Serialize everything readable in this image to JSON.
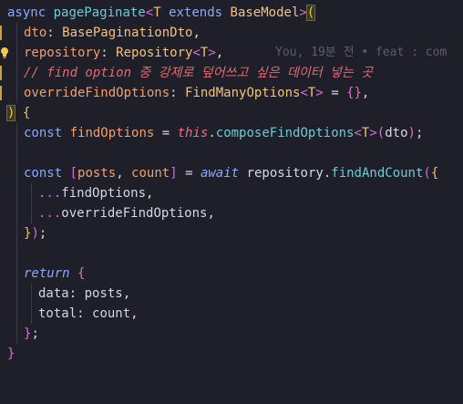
{
  "editor": {
    "line1": {
      "kw_async": "async",
      "fn_name": "pagePaginate",
      "lt": "<",
      "tparam": "T",
      "kw_extends": "extends",
      "base_type": "BaseModel",
      "gt": ">",
      "open_paren": "("
    },
    "line2": {
      "name": "dto",
      "colon": ": ",
      "type": "BasePaginationDto",
      "comma": ","
    },
    "line3": {
      "name": "repository",
      "colon": ": ",
      "type": "Repository",
      "lt": "<",
      "tparam": "T",
      "gt": ">",
      "comma": ",",
      "blame": "You, 19분 전 • feat : com"
    },
    "line4": {
      "comment": "// find option 중 강제로 덮어쓰고 싶은 데이터 넣는 곳"
    },
    "line5": {
      "name": "overrideFindOptions",
      "colon": ": ",
      "type": "FindManyOptions",
      "lt": "<",
      "tparam": "T",
      "gt": ">",
      "eq": " = ",
      "obj": "{}",
      "comma": ","
    },
    "line6": {
      "close_paren": ")",
      "open_brace": " {"
    },
    "line7": {
      "kw": "const",
      "name": "findOptions",
      "eq": " = ",
      "this_kw": "this",
      "dot": ".",
      "method": "composeFindOptions",
      "lt": "<",
      "tparam": "T",
      "gt": ">",
      "open": "(",
      "arg": "dto",
      "close": ")",
      "semi": ";"
    },
    "line9": {
      "kw": "const",
      "open_bracket": "[",
      "v1": "posts",
      "comma": ", ",
      "v2": "count",
      "close_bracket": "]",
      "eq": " = ",
      "kw_await": "await",
      "obj": "repository",
      "dot": ".",
      "method": "findAndCount",
      "open_paren": "(",
      "open_brace": "{"
    },
    "line10": {
      "spread": "...",
      "name": "findOptions",
      "comma": ","
    },
    "line11": {
      "spread": "...",
      "name": "overrideFindOptions",
      "comma": ","
    },
    "line12": {
      "close_brace": "}",
      "close_paren": ")",
      "semi": ";"
    },
    "line14": {
      "kw": "return",
      "open_brace": "{"
    },
    "line15": {
      "key": "data",
      "colon": ": ",
      "val": "posts",
      "comma": ","
    },
    "line16": {
      "key": "total",
      "colon": ": ",
      "val": "count",
      "comma": ","
    },
    "line17": {
      "close_brace": "}",
      "semi": ";"
    },
    "line18": {
      "close_brace": "}"
    }
  }
}
